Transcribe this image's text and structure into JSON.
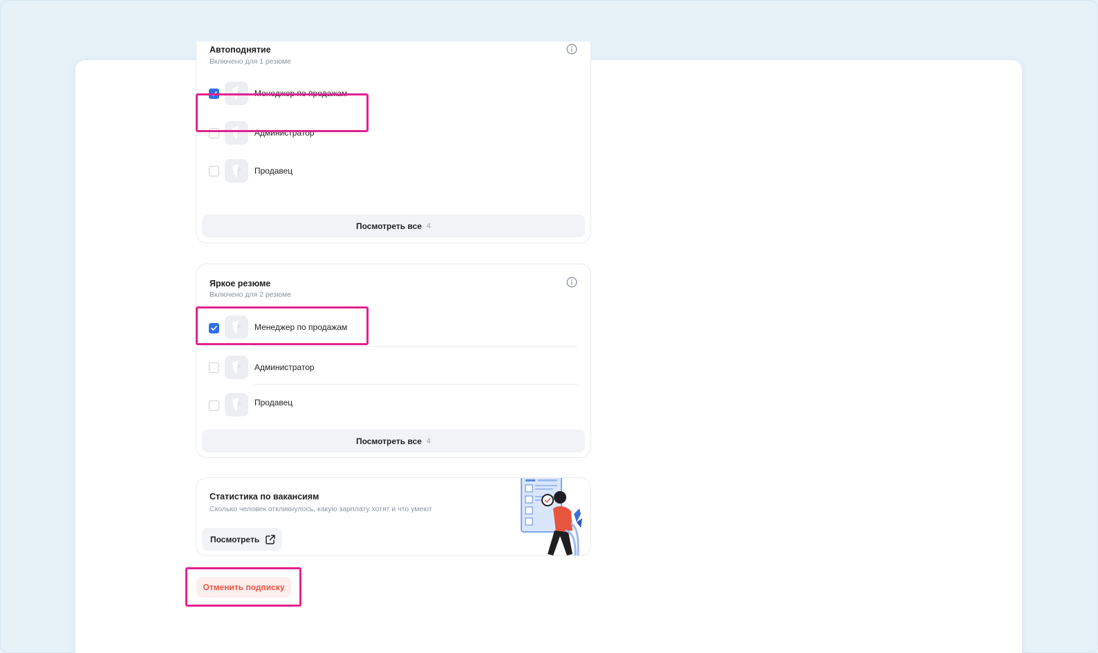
{
  "autoraise": {
    "title": "Автоподнятие",
    "subtitle": "Включено для 1 резюме",
    "items": [
      {
        "label": "Менеджер по продажам",
        "checked": true
      },
      {
        "label": "Администратор",
        "checked": false
      },
      {
        "label": "Продавец",
        "checked": false
      }
    ],
    "view_all_label": "Посмотреть все",
    "view_all_count": "4"
  },
  "bright_resume": {
    "title": "Яркое резюме",
    "subtitle": "Включено для 2 резюме",
    "items": [
      {
        "label": "Менеджер по продажам",
        "checked": true
      },
      {
        "label": "Администратор",
        "checked": false
      },
      {
        "label": "Продавец",
        "checked": false
      }
    ],
    "view_all_label": "Посмотреть все",
    "view_all_count": "4"
  },
  "vacancy_stats": {
    "title": "Статистика по вакансиям",
    "subtitle": "Сколько человек откликнулось, какую зарплату хотят и что умеют",
    "button_label": "Посмотреть"
  },
  "cancel_subscription_label": "Отменить подписку",
  "colors": {
    "accent_blue": "#2f6fe4",
    "highlight_pink": "#e3218f",
    "cancel_red": "#e8553f"
  }
}
